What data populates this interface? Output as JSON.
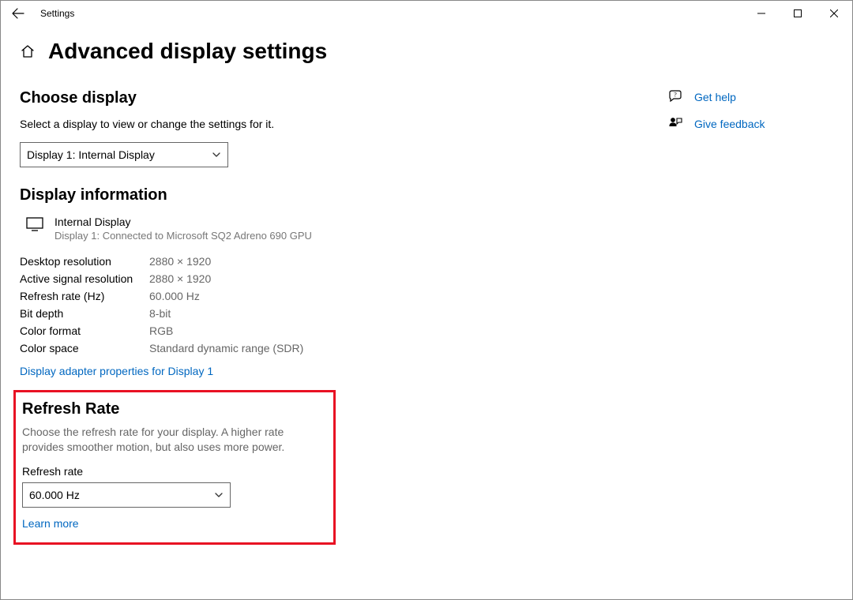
{
  "titlebar": {
    "app_name": "Settings"
  },
  "page": {
    "title": "Advanced display settings"
  },
  "choose_display": {
    "heading": "Choose display",
    "description": "Select a display to view or change the settings for it.",
    "selected": "Display 1: Internal Display"
  },
  "display_info": {
    "heading": "Display information",
    "display_name": "Internal Display",
    "display_sub": "Display 1: Connected to Microsoft SQ2 Adreno 690 GPU",
    "rows": [
      {
        "k": "Desktop resolution",
        "v": "2880 × 1920"
      },
      {
        "k": "Active signal resolution",
        "v": "2880 × 1920"
      },
      {
        "k": "Refresh rate (Hz)",
        "v": "60.000 Hz"
      },
      {
        "k": "Bit depth",
        "v": "8-bit"
      },
      {
        "k": "Color format",
        "v": "RGB"
      },
      {
        "k": "Color space",
        "v": "Standard dynamic range (SDR)"
      }
    ],
    "adapter_link": "Display adapter properties for Display 1"
  },
  "refresh_rate": {
    "heading": "Refresh Rate",
    "description": "Choose the refresh rate for your display. A higher rate provides smoother motion, but also uses more power.",
    "label": "Refresh rate",
    "selected": "60.000 Hz",
    "learn_more": "Learn more"
  },
  "side": {
    "get_help": "Get help",
    "give_feedback": "Give feedback"
  }
}
